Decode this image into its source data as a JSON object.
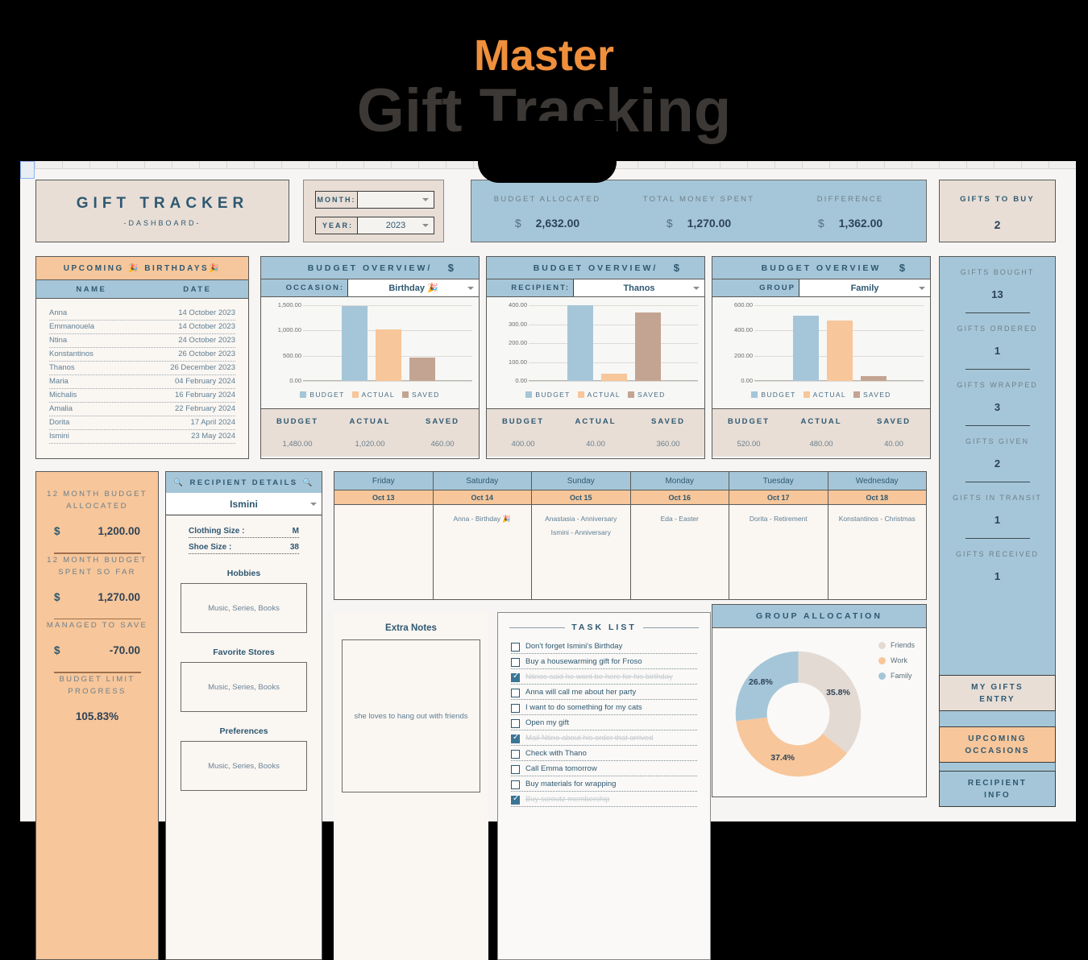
{
  "title": {
    "line1": "Master",
    "line2": "Gift Tracking",
    "accent_color": "#ef8f3c",
    "main_color": "#3b3835"
  },
  "header": {
    "tracker_title": "GIFT TRACKER",
    "tracker_sub": "-DASHBOARD-",
    "month_label": "MONTH:",
    "month_value": "",
    "year_label": "YEAR:",
    "year_value": "2023"
  },
  "summary": [
    {
      "label": "BUDGET ALLOCATED",
      "currency": "$",
      "value": "2,632.00"
    },
    {
      "label": "TOTAL MONEY SPENT",
      "currency": "$",
      "value": "1,270.00"
    },
    {
      "label": "DIFFERENCE",
      "currency": "$",
      "value": "1,362.00"
    }
  ],
  "gifts_to_buy": {
    "label": "GIFTS TO BUY",
    "value": "2"
  },
  "birthdays": {
    "title": "UPCOMING 🎉 BIRTHDAYS🎉",
    "col_name": "NAME",
    "col_date": "DATE",
    "rows": [
      {
        "name": "Anna",
        "date": "14 October 2023"
      },
      {
        "name": "Emmanouela",
        "date": "14 October 2023"
      },
      {
        "name": "Ntina",
        "date": "24 October 2023"
      },
      {
        "name": "Konstantinos",
        "date": "26 October 2023"
      },
      {
        "name": "Thanos",
        "date": "26 December 2023"
      },
      {
        "name": "Maria",
        "date": "04 February 2024"
      },
      {
        "name": "Michalis",
        "date": "16 February 2024"
      },
      {
        "name": "Amalia",
        "date": "22 February 2024"
      },
      {
        "name": "Dorita",
        "date": "17 April 2024"
      },
      {
        "name": "Ismini",
        "date": "23 May 2024"
      }
    ]
  },
  "chart_data": [
    {
      "type": "bar",
      "title": "BUDGET OVERVIEW/",
      "dollar": "$",
      "selector_label": "OCCASION:",
      "selector_value": "Birthday 🎉",
      "categories": [
        "BUDGET",
        "ACTUAL",
        "SAVED"
      ],
      "values": [
        1480.0,
        1020.0,
        460.0
      ],
      "ticks": [
        "1,500.00",
        "1,000.00",
        "500.00",
        "0.00"
      ],
      "ylim": [
        0,
        1500
      ],
      "colors": [
        "#a5c6d8",
        "#f7c69a",
        "#c3a492"
      ],
      "footer_headers": [
        "BUDGET",
        "ACTUAL",
        "SAVED"
      ],
      "footer_values": [
        "1,480.00",
        "1,020.00",
        "460.00"
      ],
      "xlabel": "",
      "ylabel": "",
      "grid": true,
      "legend": "bottom"
    },
    {
      "type": "bar",
      "title": "BUDGET OVERVIEW/",
      "dollar": "$",
      "selector_label": "RECIPIENT:",
      "selector_value": "Thanos",
      "categories": [
        "BUDGET",
        "ACTUAL",
        "SAVED"
      ],
      "values": [
        400.0,
        40.0,
        360.0
      ],
      "ticks": [
        "400.00",
        "300.00",
        "200.00",
        "100.00",
        "0.00"
      ],
      "ylim": [
        0,
        400
      ],
      "colors": [
        "#a5c6d8",
        "#f7c69a",
        "#c3a492"
      ],
      "footer_headers": [
        "BUDGET",
        "ACTUAL",
        "SAVED"
      ],
      "footer_values": [
        "400.00",
        "40.00",
        "360.00"
      ],
      "xlabel": "",
      "ylabel": "",
      "grid": true,
      "legend": "bottom"
    },
    {
      "type": "bar",
      "title": "BUDGET OVERVIEW",
      "dollar": "$",
      "selector_label": "GROUP",
      "selector_value": "Family",
      "categories": [
        "BUDGET",
        "ACTUAL",
        "SAVED"
      ],
      "values": [
        520.0,
        480.0,
        40.0
      ],
      "ticks": [
        "600.00",
        "400.00",
        "200.00",
        "0.00"
      ],
      "ylim": [
        0,
        600
      ],
      "colors": [
        "#a5c6d8",
        "#f7c69a",
        "#c3a492"
      ],
      "footer_headers": [
        "BUDGET",
        "ACTUAL",
        "SAVED"
      ],
      "footer_values": [
        "520.00",
        "480.00",
        "40.00"
      ],
      "xlabel": "",
      "ylabel": "",
      "grid": true,
      "legend": "bottom"
    },
    {
      "type": "pie",
      "title": "GROUP ALLOCATION",
      "labels": [
        "Friends",
        "Work",
        "Family"
      ],
      "values": [
        35.8,
        37.4,
        26.8
      ],
      "value_labels": [
        "35.8%",
        "37.4%",
        "26.8%"
      ],
      "colors": [
        "#e3dad3",
        "#f7c69a",
        "#a5c6d8"
      ],
      "donut": true,
      "legend": "right"
    }
  ],
  "stats": [
    {
      "label": "GIFTS BOUGHT",
      "value": "13"
    },
    {
      "label": "GIFTS ORDERED",
      "value": "1"
    },
    {
      "label": "GIFTS WRAPPED",
      "value": "3"
    },
    {
      "label": "GIFTS GIVEN",
      "value": "2"
    },
    {
      "label": "GIFTS IN TRANSIT",
      "value": "1"
    },
    {
      "label": "GIFTS RECEIVED",
      "value": "1"
    }
  ],
  "budget12": [
    {
      "label": "12 MONTH BUDGET ALLOCATED",
      "currency": "$",
      "value": "1,200.00"
    },
    {
      "label": "12 MONTH BUDGET SPENT SO FAR",
      "currency": "$",
      "value": "1,270.00"
    },
    {
      "label": "MANAGED TO SAVE",
      "currency": "$",
      "value": "-70.00"
    }
  ],
  "budget_progress": {
    "label": "BUDGET LIMIT PROGRESS",
    "value": "105.83%"
  },
  "recipient": {
    "title": "RECIPIENT DETAILS",
    "selected": "Ismini",
    "clothing_label": "Clothing Size :",
    "clothing_value": "M",
    "shoe_label": "Shoe Size :",
    "shoe_value": "38",
    "sections": [
      {
        "title": "Hobbies",
        "value": "Music, Series, Books"
      },
      {
        "title": "Favorite Stores",
        "value": "Music, Series, Books"
      },
      {
        "title": "Preferences",
        "value": "Music, Series, Books"
      }
    ]
  },
  "calendar": {
    "days": [
      "Friday",
      "Saturday",
      "Sunday",
      "Monday",
      "Tuesday",
      "Wednesday"
    ],
    "dates": [
      "Oct 13",
      "Oct 14",
      "Oct 15",
      "Oct 16",
      "Oct 17",
      "Oct 18"
    ],
    "events": [
      [],
      [
        "Anna - Birthday 🎉"
      ],
      [
        "Anastasia - Anniversary",
        "Ismini - Anniversary"
      ],
      [
        "Eda - Easter"
      ],
      [
        "Dorita - Retirement"
      ],
      [
        "Konstantinos - Christmas"
      ]
    ]
  },
  "notes": {
    "title": "Extra Notes",
    "value": "she loves to hang out with friends"
  },
  "tasks": {
    "title": "TASK LIST",
    "items": [
      {
        "text": "Don't forget Ismini's Birthday",
        "done": false
      },
      {
        "text": "Buy a housewarming gift for Froso",
        "done": false
      },
      {
        "text": "Ntinos said he wont be here for his birthday",
        "done": true
      },
      {
        "text": "Anna will call me about her party",
        "done": false
      },
      {
        "text": "I want to do something for my cats",
        "done": false
      },
      {
        "text": "Open my gift",
        "done": false
      },
      {
        "text": "Mail Ntino about his order that arrived",
        "done": true
      },
      {
        "text": "Check with Thano",
        "done": false
      },
      {
        "text": "Call Emma tomorrow",
        "done": false
      },
      {
        "text": "Buy materials for wrapping",
        "done": false
      },
      {
        "text": "Buy scroutz membership",
        "done": true
      }
    ]
  },
  "nav": [
    {
      "line1": "MY GIFTS",
      "line2": "ENTRY"
    },
    {
      "line1": "UPCOMING",
      "line2": "OCCASIONS"
    },
    {
      "line1": "RECIPIENT",
      "line2": "INFO"
    }
  ]
}
